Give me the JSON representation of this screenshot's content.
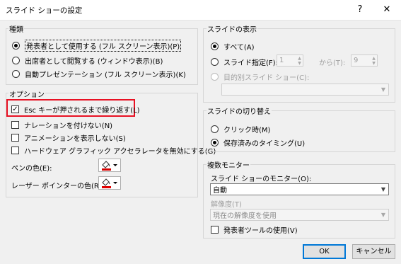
{
  "window": {
    "title": "スライド ショーの設定",
    "help_label": "?",
    "close_label": "✕"
  },
  "type_group": {
    "label": "種類",
    "options": [
      {
        "label": "発表者として使用する (フル スクリーン表示)(P)",
        "selected": true
      },
      {
        "label": "出席者として閲覧する (ウィンドウ表示)(B)",
        "selected": false
      },
      {
        "label": "自動プレゼンテーション (フル スクリーン表示)(K)",
        "selected": false
      }
    ]
  },
  "options_group": {
    "label": "オプション",
    "checkboxes": [
      {
        "label": "Esc キーが押されるまで繰り返す(L)",
        "checked": true
      },
      {
        "label": "ナレーションを付けない(N)",
        "checked": false
      },
      {
        "label": "アニメーションを表示しない(S)",
        "checked": false
      },
      {
        "label": "ハードウェア グラフィック アクセラレータを無効にする(G)",
        "checked": false
      }
    ],
    "pen_color_label": "ペンの色(E):",
    "laser_color_label": "レーザー ポインターの色(R):",
    "pen_color": "#d40000",
    "laser_color": "#e00000"
  },
  "show_slides_group": {
    "label": "スライドの表示",
    "all_label": "すべて(A)",
    "range_label": "スライド指定(F):",
    "from_value": "1",
    "to_label": "から(T):",
    "to_value": "9",
    "custom_label": "目的別スライド ショー(C):",
    "custom_value": ""
  },
  "advance_group": {
    "label": "スライドの切り替え",
    "manual_label": "クリック時(M)",
    "timings_label": "保存済みのタイミング(U)"
  },
  "monitors_group": {
    "label": "複数モニター",
    "monitor_label": "スライド ショーのモニター(O):",
    "monitor_value": "自動",
    "resolution_label": "解像度(T)",
    "resolution_value": "現在の解像度を使用",
    "presenter_view_label": "発表者ツールの使用(V)"
  },
  "buttons": {
    "ok": "OK",
    "cancel": "キャンセル"
  },
  "colors": {
    "highlight_border": "#e81123",
    "default_button_border": "#0078d7"
  }
}
